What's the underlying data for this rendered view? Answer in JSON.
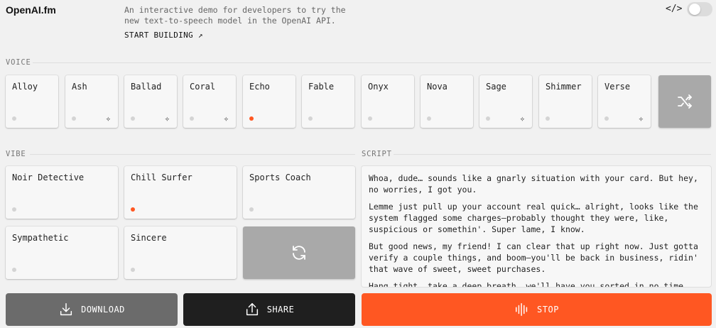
{
  "header": {
    "logo": "OpenAI.fm",
    "intro": "An interactive demo for developers to try the new text-to-speech model in the OpenAI API.",
    "start_building": "START BUILDING ↗",
    "code_icon": "</>"
  },
  "voice": {
    "label": "VOICE",
    "items": [
      {
        "name": "Alloy",
        "new": false,
        "selected": false
      },
      {
        "name": "Ash",
        "new": true,
        "selected": false
      },
      {
        "name": "Ballad",
        "new": true,
        "selected": false
      },
      {
        "name": "Coral",
        "new": true,
        "selected": false
      },
      {
        "name": "Echo",
        "new": false,
        "selected": true
      },
      {
        "name": "Fable",
        "new": false,
        "selected": false
      },
      {
        "name": "Onyx",
        "new": false,
        "selected": false
      },
      {
        "name": "Nova",
        "new": false,
        "selected": false
      },
      {
        "name": "Sage",
        "new": true,
        "selected": false
      },
      {
        "name": "Shimmer",
        "new": false,
        "selected": false
      },
      {
        "name": "Verse",
        "new": true,
        "selected": false
      }
    ]
  },
  "vibe": {
    "label": "VIBE",
    "items": [
      {
        "name": "Noir Detective",
        "selected": false
      },
      {
        "name": "Chill Surfer",
        "selected": true
      },
      {
        "name": "Sports Coach",
        "selected": false
      },
      {
        "name": "Sympathetic",
        "selected": false
      },
      {
        "name": "Sincere",
        "selected": false
      }
    ]
  },
  "script": {
    "label": "SCRIPT",
    "paragraphs": [
      "Whoa, dude… sounds like a gnarly situation with your card. But hey, no worries, I got you.",
      "Lemme just pull up your account real quick… alright, looks like the system flagged some charges—probably thought they were, like, suspicious or somethin'. Super lame, I know.",
      "But good news, my friend! I can clear that up right now. Just gotta verify a couple things, and boom—you'll be back in business, ridin' that wave of sweet, sweet purchases.",
      "Hang tight, take a deep breath, we'll have you sorted in no time. Sound good?"
    ]
  },
  "actions": {
    "download": "DOWNLOAD",
    "share": "SHARE",
    "stop": "STOP"
  },
  "colors": {
    "accent": "#ff5722",
    "background": "#f1f1f1",
    "card": "#f7f7f7",
    "gray_card": "#a9a9a9"
  }
}
